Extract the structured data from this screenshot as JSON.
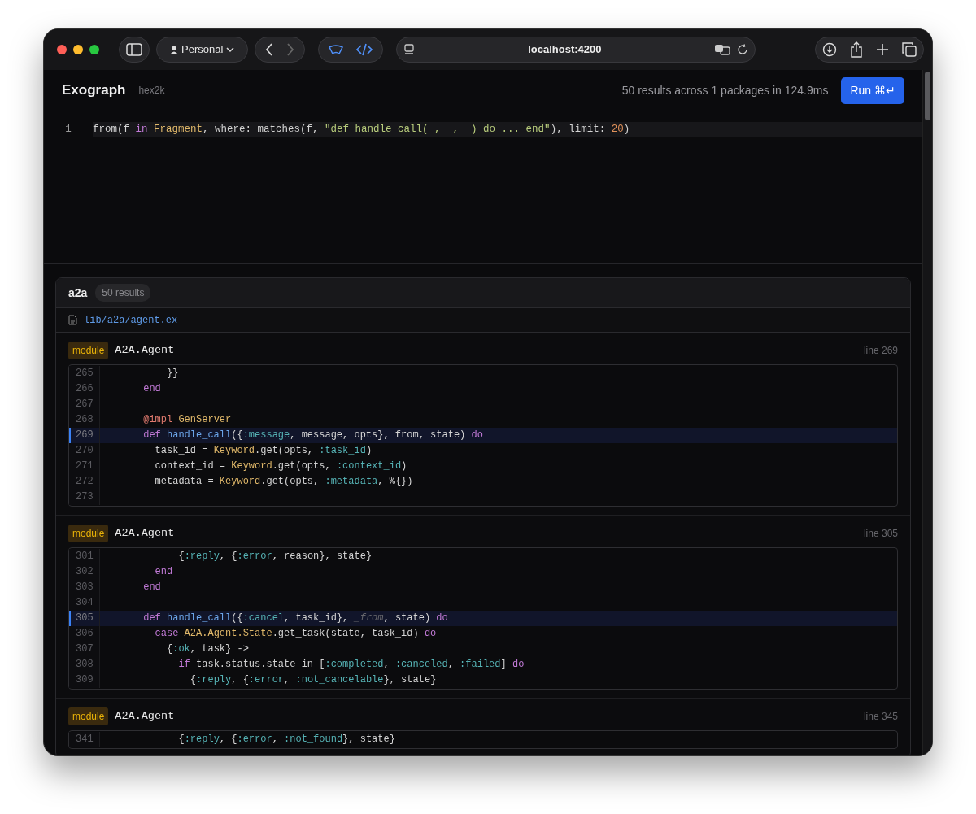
{
  "browser": {
    "profile": "Personal",
    "back": {
      "disabled": false
    },
    "forward": {
      "disabled": true
    },
    "url": "localhost:4200"
  },
  "app": {
    "title": "Exograph",
    "subtitle": "hex2k",
    "stats": "50 results across 1 packages in 124.9ms",
    "run_button": "Run ⌘↵"
  },
  "query": {
    "lines": [
      {
        "number": "1",
        "selected": true,
        "tokens": [
          {
            "text": "from(f ",
            "kind": "plain"
          },
          {
            "text": "in",
            "kind": "kw"
          },
          {
            "text": " Fragment",
            "kind": "mod"
          },
          {
            "text": ", where: matches(f, ",
            "kind": "plain"
          },
          {
            "text": "\"def handle_call(_, _, _) do ... end\"",
            "kind": "str"
          },
          {
            "text": "), limit: ",
            "kind": "plain"
          },
          {
            "text": "20",
            "kind": "num"
          },
          {
            "text": ")",
            "kind": "plain"
          }
        ]
      }
    ]
  },
  "results": [
    {
      "package": "a2a",
      "count": "50 results",
      "file": "lib/a2a/agent.ex",
      "matches": [
        {
          "kind_label": "module",
          "name": "A2A.Agent",
          "line_label": "line 269",
          "lines": [
            {
              "number": "265",
              "selected": false,
              "tokens": [
                {
                  "text": "          }}",
                  "kind": "plain"
                }
              ]
            },
            {
              "number": "266",
              "selected": false,
              "tokens": [
                {
                  "text": "      end",
                  "kind": "kw"
                }
              ]
            },
            {
              "number": "267",
              "selected": false
            },
            {
              "number": "268",
              "selected": false,
              "tokens": [
                {
                  "text": "      @impl",
                  "kind": "attr"
                },
                {
                  "text": " GenServer",
                  "kind": "mod"
                }
              ]
            },
            {
              "number": "269",
              "selected": true,
              "tokens": [
                {
                  "text": "      def",
                  "kind": "kw"
                },
                {
                  "text": " handle_call",
                  "kind": "fn"
                },
                {
                  "text": "({",
                  "kind": "plain"
                },
                {
                  "text": ":message",
                  "kind": "atom"
                },
                {
                  "text": ", message, opts}, from, state) ",
                  "kind": "plain"
                },
                {
                  "text": "do",
                  "kind": "kw"
                }
              ]
            },
            {
              "number": "270",
              "selected": false,
              "tokens": [
                {
                  "text": "        task_id = ",
                  "kind": "plain"
                },
                {
                  "text": "Keyword",
                  "kind": "mod"
                },
                {
                  "text": ".get(opts, ",
                  "kind": "plain"
                },
                {
                  "text": ":task_id",
                  "kind": "atom"
                },
                {
                  "text": ")",
                  "kind": "plain"
                }
              ]
            },
            {
              "number": "271",
              "selected": false,
              "tokens": [
                {
                  "text": "        context_id = ",
                  "kind": "plain"
                },
                {
                  "text": "Keyword",
                  "kind": "mod"
                },
                {
                  "text": ".get(opts, ",
                  "kind": "plain"
                },
                {
                  "text": ":context_id",
                  "kind": "atom"
                },
                {
                  "text": ")",
                  "kind": "plain"
                }
              ]
            },
            {
              "number": "272",
              "selected": false,
              "tokens": [
                {
                  "text": "        metadata = ",
                  "kind": "plain"
                },
                {
                  "text": "Keyword",
                  "kind": "mod"
                },
                {
                  "text": ".get(opts, ",
                  "kind": "plain"
                },
                {
                  "text": ":metadata",
                  "kind": "atom"
                },
                {
                  "text": ", %{})",
                  "kind": "plain"
                }
              ]
            },
            {
              "number": "273",
              "selected": false
            }
          ]
        },
        {
          "kind_label": "module",
          "name": "A2A.Agent",
          "line_label": "line 305",
          "lines": [
            {
              "number": "301",
              "selected": false,
              "tokens": [
                {
                  "text": "            {",
                  "kind": "plain"
                },
                {
                  "text": ":reply",
                  "kind": "atom"
                },
                {
                  "text": ", {",
                  "kind": "plain"
                },
                {
                  "text": ":error",
                  "kind": "atom"
                },
                {
                  "text": ", reason}, state}",
                  "kind": "plain"
                }
              ]
            },
            {
              "number": "302",
              "selected": false,
              "tokens": [
                {
                  "text": "        end",
                  "kind": "kw"
                }
              ]
            },
            {
              "number": "303",
              "selected": false,
              "tokens": [
                {
                  "text": "      end",
                  "kind": "kw"
                }
              ]
            },
            {
              "number": "304",
              "selected": false
            },
            {
              "number": "305",
              "selected": true,
              "tokens": [
                {
                  "text": "      def",
                  "kind": "kw"
                },
                {
                  "text": " handle_call",
                  "kind": "fn"
                },
                {
                  "text": "({",
                  "kind": "plain"
                },
                {
                  "text": ":cancel",
                  "kind": "atom"
                },
                {
                  "text": ", task_id}, ",
                  "kind": "plain"
                },
                {
                  "text": "_from",
                  "kind": "unused"
                },
                {
                  "text": ", state) ",
                  "kind": "plain"
                },
                {
                  "text": "do",
                  "kind": "kw"
                }
              ]
            },
            {
              "number": "306",
              "selected": false,
              "tokens": [
                {
                  "text": "        case",
                  "kind": "kw"
                },
                {
                  "text": " A2A.Agent.State",
                  "kind": "mod"
                },
                {
                  "text": ".get_task(state, task_id) ",
                  "kind": "plain"
                },
                {
                  "text": "do",
                  "kind": "kw"
                }
              ]
            },
            {
              "number": "307",
              "selected": false,
              "tokens": [
                {
                  "text": "          {",
                  "kind": "plain"
                },
                {
                  "text": ":ok",
                  "kind": "atom"
                },
                {
                  "text": ", task} ->",
                  "kind": "plain"
                }
              ]
            },
            {
              "number": "308",
              "selected": false,
              "tokens": [
                {
                  "text": "            if",
                  "kind": "kw"
                },
                {
                  "text": " task.status.state in [",
                  "kind": "plain"
                },
                {
                  "text": ":completed",
                  "kind": "atom"
                },
                {
                  "text": ", ",
                  "kind": "plain"
                },
                {
                  "text": ":canceled",
                  "kind": "atom"
                },
                {
                  "text": ", ",
                  "kind": "plain"
                },
                {
                  "text": ":failed",
                  "kind": "atom"
                },
                {
                  "text": "] ",
                  "kind": "plain"
                },
                {
                  "text": "do",
                  "kind": "kw"
                }
              ]
            },
            {
              "number": "309",
              "selected": false,
              "tokens": [
                {
                  "text": "              {",
                  "kind": "plain"
                },
                {
                  "text": ":reply",
                  "kind": "atom"
                },
                {
                  "text": ", {",
                  "kind": "plain"
                },
                {
                  "text": ":error",
                  "kind": "atom"
                },
                {
                  "text": ", ",
                  "kind": "plain"
                },
                {
                  "text": ":not_cancelable",
                  "kind": "atom"
                },
                {
                  "text": "}, state}",
                  "kind": "plain"
                }
              ]
            }
          ]
        },
        {
          "kind_label": "module",
          "name": "A2A.Agent",
          "line_label": "line 345",
          "lines": [
            {
              "number": "341",
              "selected": false,
              "tokens": [
                {
                  "text": "            {",
                  "kind": "plain"
                },
                {
                  "text": ":reply",
                  "kind": "atom"
                },
                {
                  "text": ", {",
                  "kind": "plain"
                },
                {
                  "text": ":error",
                  "kind": "atom"
                },
                {
                  "text": ", ",
                  "kind": "plain"
                },
                {
                  "text": ":not_found",
                  "kind": "atom"
                },
                {
                  "text": "}, state}",
                  "kind": "plain"
                }
              ]
            }
          ]
        }
      ]
    }
  ]
}
